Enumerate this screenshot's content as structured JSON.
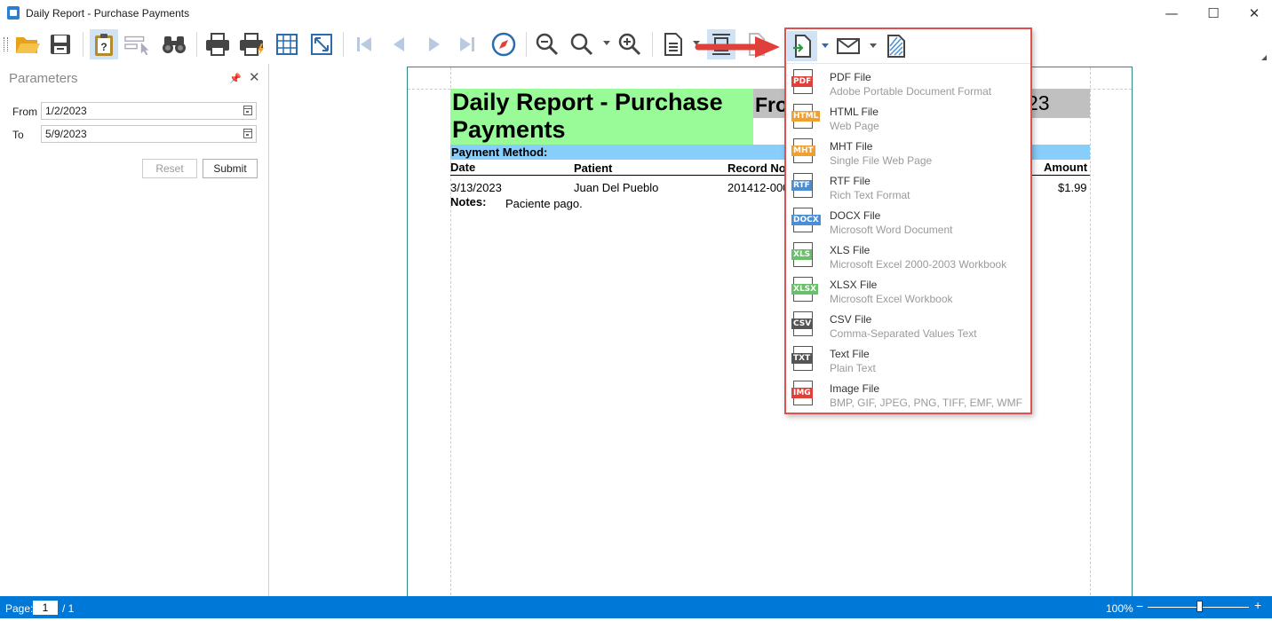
{
  "window": {
    "title": "Daily Report - Purchase Payments",
    "minimize": "—",
    "maximize": "☐",
    "close": "✕"
  },
  "toolbar": {
    "buttons": [
      {
        "name": "open",
        "icon": "folder-open-icon"
      },
      {
        "name": "save",
        "icon": "save-icon"
      },
      {
        "name": "parameters",
        "icon": "clipboard-question-icon",
        "active": true
      },
      {
        "name": "editing-fields",
        "icon": "select-cursor-icon",
        "disabled": true
      },
      {
        "name": "search",
        "icon": "binoculars-icon"
      },
      {
        "name": "print",
        "icon": "printer-icon"
      },
      {
        "name": "quick-print",
        "icon": "printer-lightning-icon"
      },
      {
        "name": "page-setup",
        "icon": "grid-icon"
      },
      {
        "name": "scale",
        "icon": "fit-arrows-icon"
      },
      {
        "name": "first-page",
        "icon": "first-page-icon",
        "disabled": true
      },
      {
        "name": "previous-page",
        "icon": "previous-page-icon",
        "disabled": true
      },
      {
        "name": "next-page",
        "icon": "next-page-icon",
        "disabled": true
      },
      {
        "name": "last-page",
        "icon": "last-page-icon",
        "disabled": true
      },
      {
        "name": "navigation",
        "icon": "compass-icon"
      },
      {
        "name": "zoom-out",
        "icon": "zoom-out-icon"
      },
      {
        "name": "zoom",
        "icon": "zoom-icon"
      },
      {
        "name": "zoom-in",
        "icon": "zoom-in-icon"
      },
      {
        "name": "multiple-pages",
        "icon": "document-list-icon"
      },
      {
        "name": "page-layout",
        "icon": "page-layout-icon",
        "active": true
      },
      {
        "name": "open-file",
        "icon": "document-icon",
        "disabled": true
      },
      {
        "name": "export",
        "icon": "export-document-icon",
        "active": true
      },
      {
        "name": "send-email",
        "icon": "envelope-icon"
      },
      {
        "name": "watermark",
        "icon": "watermark-icon"
      }
    ]
  },
  "parameters": {
    "title": "Parameters",
    "pin": "📌",
    "close": "✕",
    "from_label": "From",
    "from_value": "1/2/2023",
    "to_label": "To",
    "to_value": "5/9/2023",
    "reset_label": "Reset",
    "submit_label": "Submit"
  },
  "report": {
    "title": "Daily Report - Purchase Payments",
    "from_text": "Fro",
    "from_tail": "23",
    "payment_method_label": "Payment Method:",
    "headers": {
      "date": "Date",
      "patient": "Patient",
      "record": "Record No",
      "amount": "Amount"
    },
    "row": {
      "date": "3/13/2023",
      "patient": "Juan Del Pueblo",
      "record": "201412-000",
      "amount": "$1.99"
    },
    "notes_label": "Notes:",
    "notes_value": "Paciente pago."
  },
  "export_menu": {
    "items": [
      {
        "badge": "PDF",
        "color": "#e0403a",
        "title": "PDF File",
        "subtitle": "Adobe Portable Document Format"
      },
      {
        "badge": "HTML",
        "color": "#f0a030",
        "title": "HTML File",
        "subtitle": "Web Page"
      },
      {
        "badge": "MHT",
        "color": "#f0a030",
        "title": "MHT File",
        "subtitle": "Single File Web Page"
      },
      {
        "badge": "RTF",
        "color": "#4a8ed6",
        "title": "RTF File",
        "subtitle": "Rich Text Format"
      },
      {
        "badge": "DOCX",
        "color": "#4a8ed6",
        "title": "DOCX File",
        "subtitle": "Microsoft Word Document"
      },
      {
        "badge": "XLS",
        "color": "#6abf6a",
        "title": "XLS File",
        "subtitle": "Microsoft Excel 2000-2003 Workbook"
      },
      {
        "badge": "XLSX",
        "color": "#6abf6a",
        "title": "XLSX File",
        "subtitle": "Microsoft Excel Workbook"
      },
      {
        "badge": "CSV",
        "color": "#555555",
        "title": "CSV File",
        "subtitle": "Comma-Separated Values Text"
      },
      {
        "badge": "TXT",
        "color": "#555555",
        "title": "Text File",
        "subtitle": "Plain Text"
      },
      {
        "badge": "IMG",
        "color": "#e0403a",
        "title": "Image File",
        "subtitle": "BMP, GIF, JPEG, PNG, TIFF, EMF, WMF"
      }
    ]
  },
  "status": {
    "page_label": "Page:",
    "page_value": "1",
    "page_total": "/ 1",
    "zoom": "100%",
    "zoom_minus": "−",
    "zoom_plus": "+",
    "zoom_level": 0.5
  },
  "colors": {
    "accent": "#0078d7",
    "title_band": "#98fb98",
    "from_band": "#c0c0c0",
    "payment_band": "#87cefa",
    "highlight": "#e05050",
    "active_button": "#cfe3f5"
  }
}
